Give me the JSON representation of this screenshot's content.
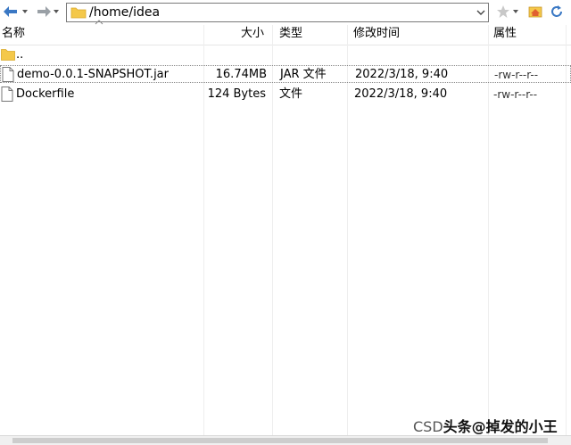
{
  "address_bar": {
    "path": "/home/idea"
  },
  "columns": {
    "name": "名称",
    "size": "大小",
    "type": "类型",
    "modified": "修改时间",
    "attributes": "属性"
  },
  "parent_row": {
    "name": ".."
  },
  "files": [
    {
      "name": "demo-0.0.1-SNAPSHOT.jar",
      "size": "16.74MB",
      "type": "JAR 文件",
      "modified": "2022/3/18, 9:40",
      "attributes": "-rw-r--r--"
    },
    {
      "name": "Dockerfile",
      "size": "124 Bytes",
      "type": "文件",
      "modified": "2022/3/18, 9:40",
      "attributes": "-rw-r--r--"
    }
  ],
  "watermark": {
    "prefix": "CSD",
    "main": "头条@掉发的小王"
  },
  "colors": {
    "accent_blue": "#3a78c4",
    "folder_yellow": "#f4c84a",
    "header_border": "#e5e5e5"
  },
  "icons": {
    "back": "back-arrow-icon",
    "forward": "forward-arrow-icon",
    "folder": "folder-icon",
    "file": "file-icon",
    "bookmark": "star-icon",
    "home": "home-icon",
    "refresh": "refresh-icon"
  }
}
